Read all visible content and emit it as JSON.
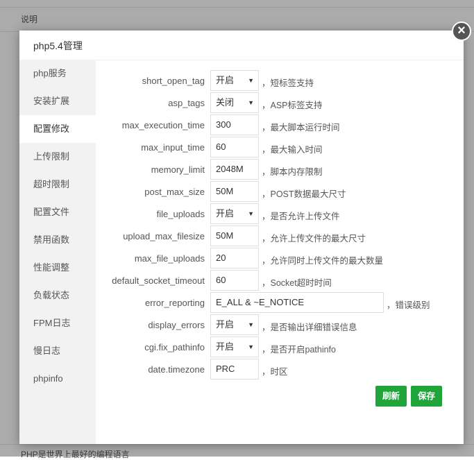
{
  "background": {
    "top_text": "说明",
    "bottom_text": "PHP是世界上最好的编程语言"
  },
  "modal": {
    "title": "php5.4管理",
    "close_symbol": "×"
  },
  "sidebar": {
    "items": [
      {
        "label": "php服务"
      },
      {
        "label": "安装扩展"
      },
      {
        "label": "配置修改",
        "active": true
      },
      {
        "label": "上传限制"
      },
      {
        "label": "超时限制"
      },
      {
        "label": "配置文件"
      },
      {
        "label": "禁用函数"
      },
      {
        "label": "性能调整"
      },
      {
        "label": "负载状态"
      },
      {
        "label": "FPM日志"
      },
      {
        "label": "慢日志"
      },
      {
        "label": "phpinfo"
      }
    ]
  },
  "settings": [
    {
      "label": "short_open_tag",
      "type": "select",
      "value": "开启",
      "desc": "，短标签支持"
    },
    {
      "label": "asp_tags",
      "type": "select",
      "value": "关闭",
      "desc": "，ASP标签支持"
    },
    {
      "label": "max_execution_time",
      "type": "input",
      "value": "300",
      "desc": "，最大脚本运行时间"
    },
    {
      "label": "max_input_time",
      "type": "input",
      "value": "60",
      "desc": "，最大输入时间"
    },
    {
      "label": "memory_limit",
      "type": "input",
      "value": "2048M",
      "desc": "，脚本内存限制"
    },
    {
      "label": "post_max_size",
      "type": "input",
      "value": "50M",
      "desc": "，POST数据最大尺寸"
    },
    {
      "label": "file_uploads",
      "type": "select",
      "value": "开启",
      "desc": "，是否允许上传文件"
    },
    {
      "label": "upload_max_filesize",
      "type": "input",
      "value": "50M",
      "desc": "，允许上传文件的最大尺寸"
    },
    {
      "label": "max_file_uploads",
      "type": "input",
      "value": "20",
      "desc": "，允许同时上传文件的最大数量"
    },
    {
      "label": "default_socket_timeout",
      "type": "input",
      "value": "60",
      "desc": "，Socket超时时间"
    },
    {
      "label": "error_reporting",
      "type": "wide",
      "value": "E_ALL & ~E_NOTICE",
      "desc": "，错误级别"
    },
    {
      "label": "display_errors",
      "type": "select",
      "value": "开启",
      "desc": "，是否输出详细错误信息"
    },
    {
      "label": "cgi.fix_pathinfo",
      "type": "select",
      "value": "开启",
      "desc": "，是否开启pathinfo"
    },
    {
      "label": "date.timezone",
      "type": "input",
      "value": "PRC",
      "desc": "，时区"
    }
  ],
  "buttons": {
    "refresh": "刷新",
    "save": "保存"
  },
  "colors": {
    "accent": "#20a53a",
    "sidebar_bg": "#f2f2f2"
  }
}
